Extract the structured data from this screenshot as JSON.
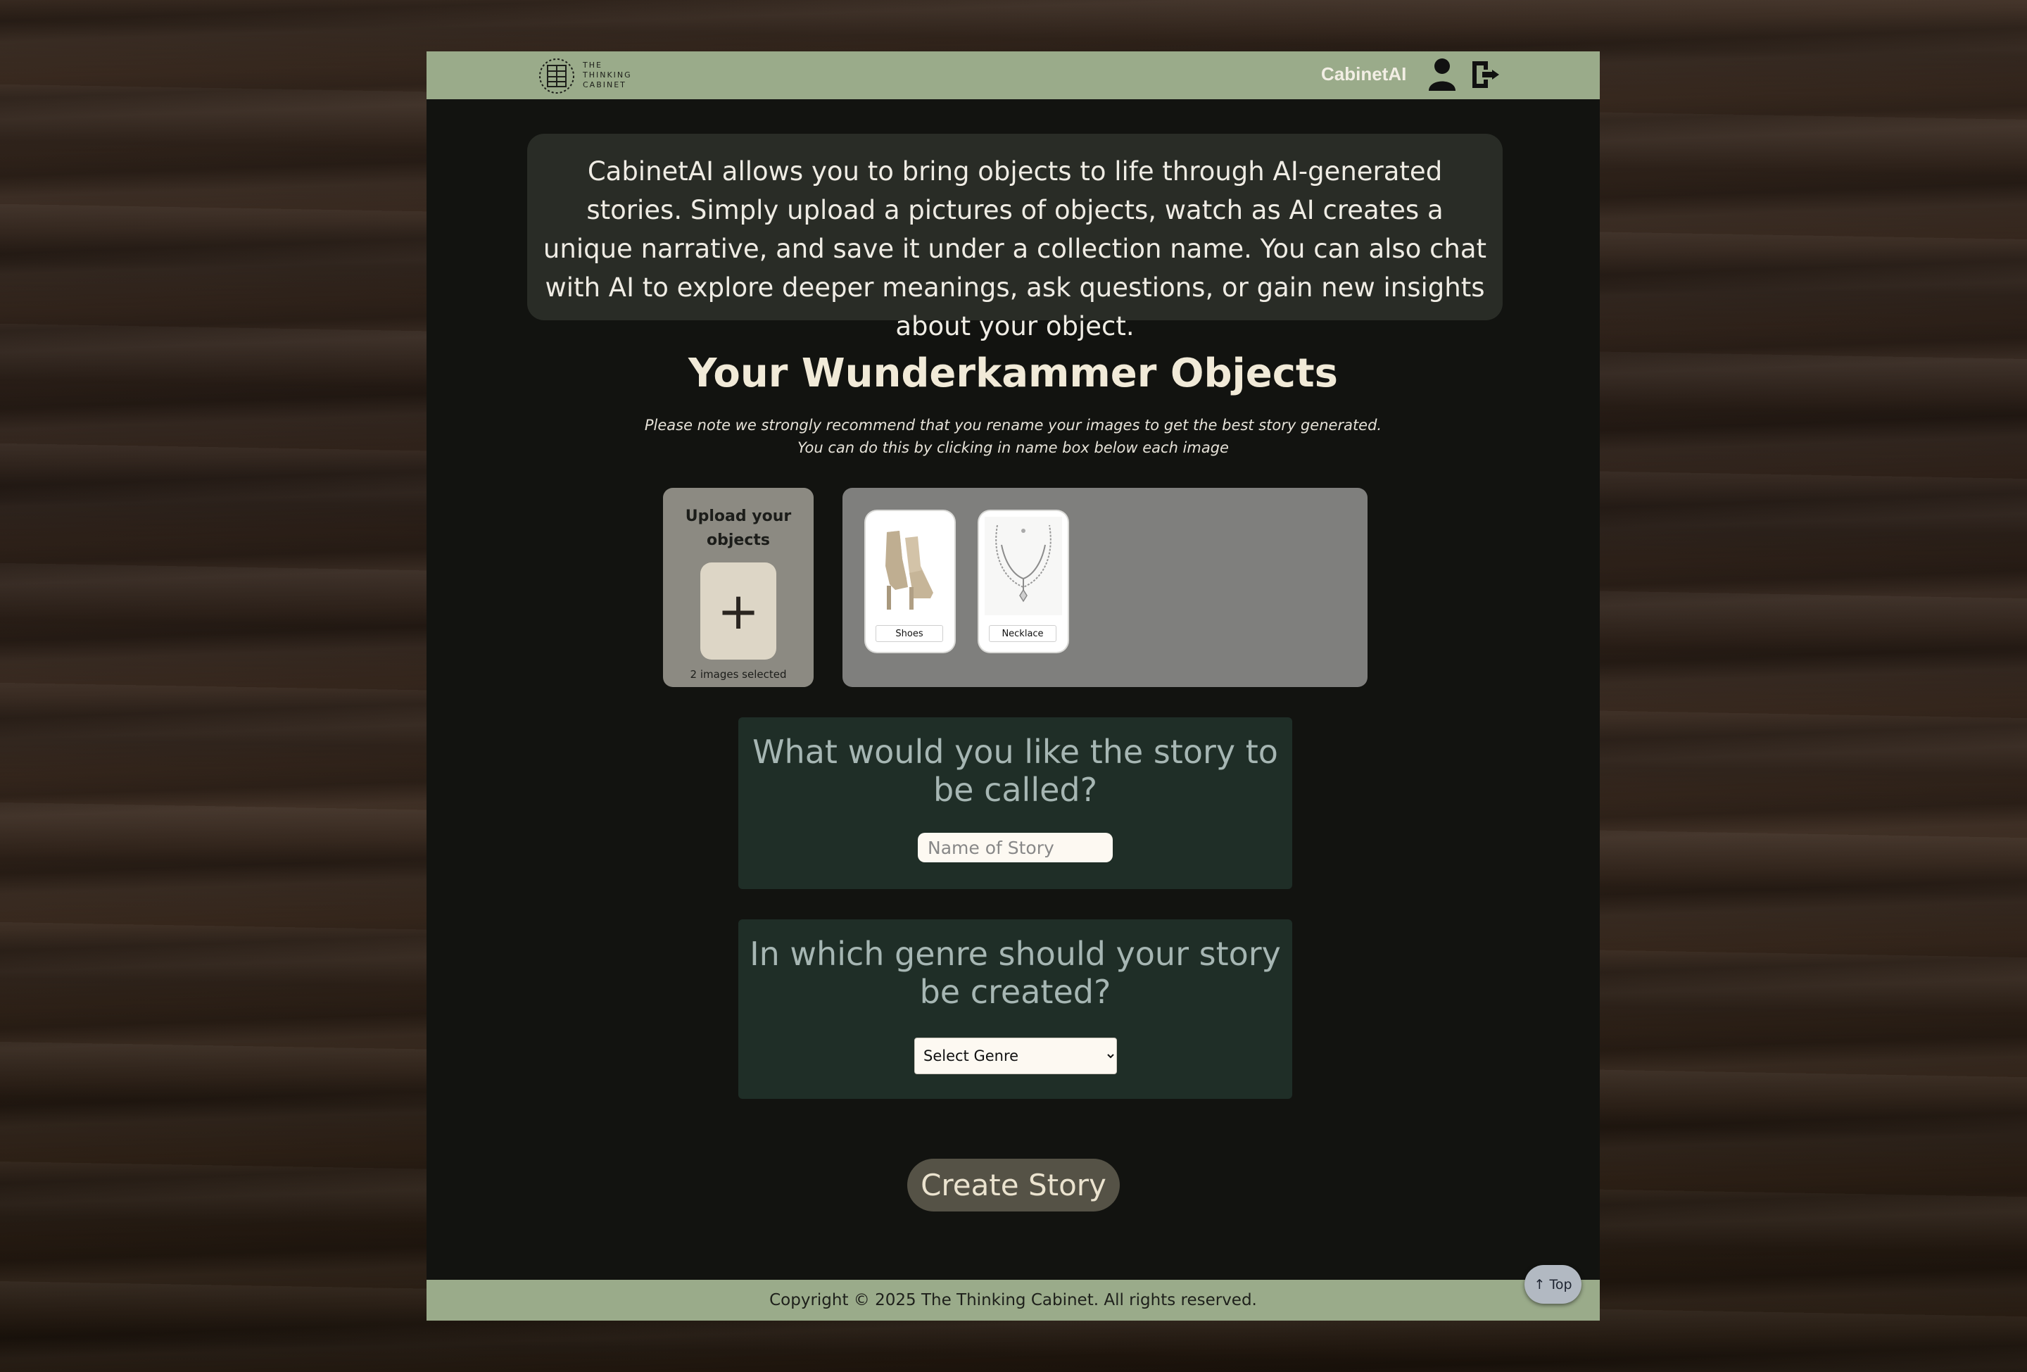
{
  "header": {
    "logo_text": "THE\nTHINKING\nCABINET",
    "brand": "CabinetAI",
    "profile_icon": "user-icon",
    "logout_icon": "logout-icon"
  },
  "intro": {
    "text": "CabinetAI allows you to bring objects to life through AI-generated stories. Simply upload a pictures of objects, watch as AI creates a unique narrative, and save it under a collection name. You can also chat with AI to explore deeper meanings, ask questions, or gain new insights about your object."
  },
  "main": {
    "heading": "Your Wunderkammer Objects",
    "note_line1": "Please note we strongly recommend that you rename your images to get the best story generated.",
    "note_line2": "You can do this by clicking in name box below each image"
  },
  "upload": {
    "title": "Upload your objects",
    "button_label": "+",
    "count_text": "2 images selected"
  },
  "objects": [
    {
      "name": "Shoes",
      "icon": "ankle-boots-image"
    },
    {
      "name": "Necklace",
      "icon": "necklace-image"
    }
  ],
  "story_name": {
    "question": "What would you like the story to be called?",
    "placeholder": "Name of Story",
    "value": ""
  },
  "genre": {
    "question": "In which genre should your story be created?",
    "selected": "Select Genre"
  },
  "actions": {
    "create_label": "Create Story",
    "top_label": "↑ Top"
  },
  "footer": {
    "copyright": "Copyright © 2025 The Thinking Cabinet. All rights reserved."
  },
  "colors": {
    "header_bg": "#9aab8a",
    "page_bg": "#121310",
    "question_bg": "#1f2e27",
    "question_text": "#a6b6b3",
    "create_button": "#555246"
  }
}
